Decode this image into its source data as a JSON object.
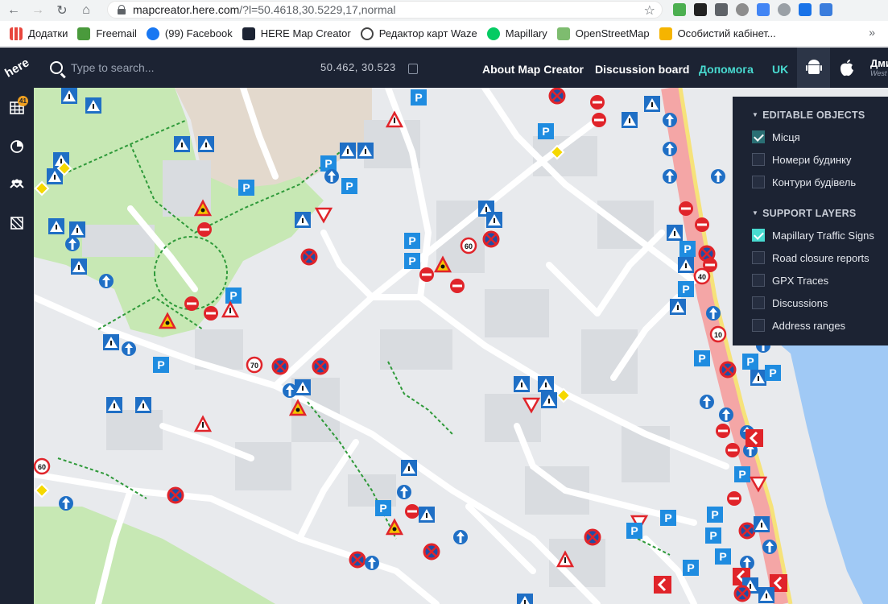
{
  "browser": {
    "url_host": "mapcreator.here.com",
    "url_path": "/?l=50.4618,30.5229,17,normal",
    "bookmarks": [
      {
        "label": "Додатки",
        "color": "#e8453c"
      },
      {
        "label": "Freemail",
        "color": "#4a9a3c"
      },
      {
        "label": "(99) Facebook",
        "color": "#1877f2"
      },
      {
        "label": "HERE Map Creator",
        "color": "#1c2333"
      },
      {
        "label": "Редактор карт Waze",
        "color": "#33ccff"
      },
      {
        "label": "Mapillary",
        "color": "#05cb63"
      },
      {
        "label": "OpenStreetMap",
        "color": "#7ebc6f"
      },
      {
        "label": "Особистий кабінет...",
        "color": "#f5b400"
      }
    ],
    "more": "»"
  },
  "app": {
    "logo": "here",
    "search_placeholder": "Type to search...",
    "coords": "50.462, 30.523",
    "nav": {
      "about": "About Map Creator",
      "discussion": "Discussion board",
      "help": "Допомога",
      "lang": "UK"
    },
    "user_name": "Дми",
    "user_sub": "West",
    "accent": "#48dad0",
    "bar_color": "#1c2333"
  },
  "sidebar": {
    "badge": "41",
    "icons": [
      "table-icon",
      "pie-chart-icon",
      "people-icon",
      "map-overlay-icon"
    ]
  },
  "layers": {
    "editable_title": "EDITABLE OBJECTS",
    "editable": [
      {
        "label": "Місця",
        "checked": true
      },
      {
        "label": "Номери будинку",
        "checked": false
      },
      {
        "label": "Контури будівель",
        "checked": false
      }
    ],
    "support_title": "SUPPORT LAYERS",
    "support": [
      {
        "label": "Mapillary Traffic Signs",
        "checked": true
      },
      {
        "label": "Road closure reports",
        "checked": false
      },
      {
        "label": "GPX Traces",
        "checked": false
      },
      {
        "label": "Discussions",
        "checked": false
      },
      {
        "label": "Address ranges",
        "checked": false
      }
    ]
  },
  "map": {
    "signs": {
      "speed_limits": [
        "60",
        "70",
        "60",
        "40",
        "10",
        "40"
      ],
      "parking": "P"
    }
  }
}
